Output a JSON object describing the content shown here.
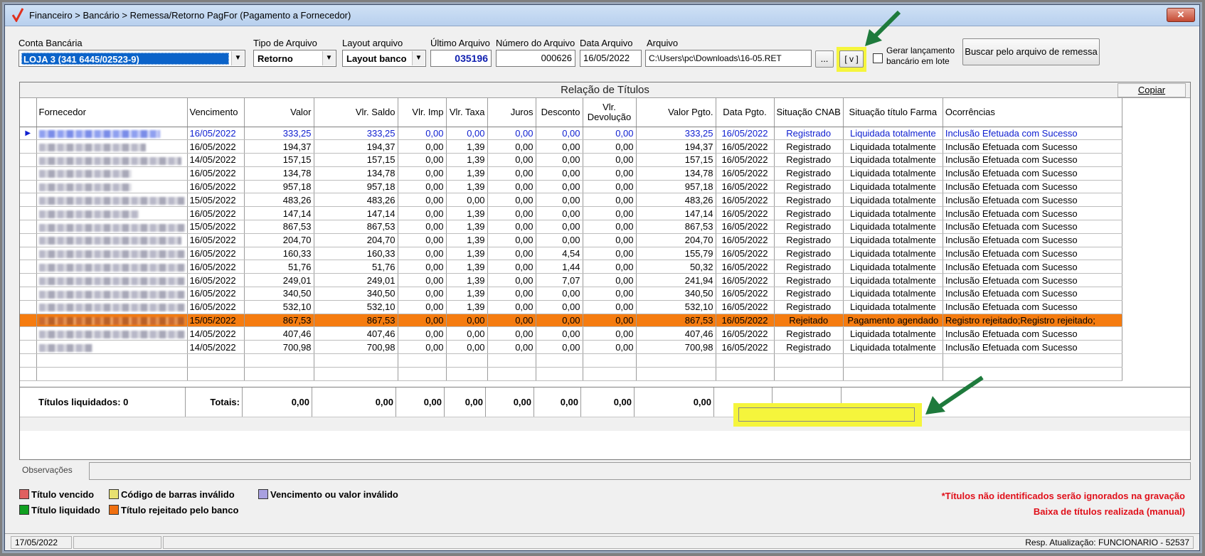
{
  "window": {
    "title": "Financeiro > Bancário > Remessa/Retorno PagFor (Pagamento  a Fornecedor)",
    "close_label": "✕"
  },
  "filters": {
    "conta_label": "Conta Bancária",
    "conta_value": "LOJA 3 (341 6445/02523-9)",
    "tipo_label": "Tipo de Arquivo",
    "tipo_value": "Retorno",
    "layout_label": "Layout arquivo",
    "layout_value": "Layout banco",
    "ultimo_label": "Último Arquivo",
    "ultimo_value": "035196",
    "numero_label": "Número do Arquivo",
    "numero_value": "000626",
    "data_label": "Data Arquivo",
    "data_value": "16/05/2022",
    "arquivo_label": "Arquivo",
    "arquivo_value": "C:\\Users\\pc\\Downloads\\16-05.RET",
    "browse_label": "...",
    "validate_label": "[ v ]",
    "gerar_label_1": "Gerar lançamento",
    "gerar_label_2": "bancário em lote",
    "buscar_label": "Buscar pelo arquivo de remessa"
  },
  "grid": {
    "caption": "Relação de Títulos",
    "copiar_label": "Copiar",
    "columns": [
      {
        "label": "Fornecedor"
      },
      {
        "label": "Vencimento"
      },
      {
        "label": "Valor"
      },
      {
        "label": "Vlr. Saldo"
      },
      {
        "label": "Vlr. Imp"
      },
      {
        "label": "Vlr. Taxa"
      },
      {
        "label": "Juros"
      },
      {
        "label": "Desconto"
      },
      {
        "label": "Vlr. Devolução"
      },
      {
        "label": "Valor Pgto."
      },
      {
        "label": "Data Pgto."
      },
      {
        "label": "Situação CNAB"
      },
      {
        "label": "Situação título Farma"
      },
      {
        "label": "Ocorrências"
      }
    ],
    "rows": [
      {
        "w": 170,
        "venc": "16/05/2022",
        "valor": "333,25",
        "saldo": "333,25",
        "imp": "0,00",
        "taxa": "0,00",
        "juros": "0,00",
        "desc": "0,00",
        "devol": "0,00",
        "pgto": "333,25",
        "data": "16/05/2022",
        "cnab": "Registrado",
        "farma": "Liquidada totalmente",
        "ocor": "Inclusão Efetuada com Sucesso",
        "style": "blue",
        "current": true
      },
      {
        "w": 150,
        "venc": "16/05/2022",
        "valor": "194,37",
        "saldo": "194,37",
        "imp": "0,00",
        "taxa": "1,39",
        "juros": "0,00",
        "desc": "0,00",
        "devol": "0,00",
        "pgto": "194,37",
        "data": "16/05/2022",
        "cnab": "Registrado",
        "farma": "Liquidada totalmente",
        "ocor": "Inclusão Efetuada com Sucesso",
        "style": ""
      },
      {
        "w": 200,
        "venc": "14/05/2022",
        "valor": "157,15",
        "saldo": "157,15",
        "imp": "0,00",
        "taxa": "1,39",
        "juros": "0,00",
        "desc": "0,00",
        "devol": "0,00",
        "pgto": "157,15",
        "data": "16/05/2022",
        "cnab": "Registrado",
        "farma": "Liquidada totalmente",
        "ocor": "Inclusão Efetuada com Sucesso",
        "style": ""
      },
      {
        "w": 130,
        "venc": "16/05/2022",
        "valor": "134,78",
        "saldo": "134,78",
        "imp": "0,00",
        "taxa": "1,39",
        "juros": "0,00",
        "desc": "0,00",
        "devol": "0,00",
        "pgto": "134,78",
        "data": "16/05/2022",
        "cnab": "Registrado",
        "farma": "Liquidada totalmente",
        "ocor": "Inclusão Efetuada com Sucesso",
        "style": ""
      },
      {
        "w": 130,
        "venc": "16/05/2022",
        "valor": "957,18",
        "saldo": "957,18",
        "imp": "0,00",
        "taxa": "1,39",
        "juros": "0,00",
        "desc": "0,00",
        "devol": "0,00",
        "pgto": "957,18",
        "data": "16/05/2022",
        "cnab": "Registrado",
        "farma": "Liquidada totalmente",
        "ocor": "Inclusão Efetuada com Sucesso",
        "style": ""
      },
      {
        "w": 205,
        "venc": "15/05/2022",
        "valor": "483,26",
        "saldo": "483,26",
        "imp": "0,00",
        "taxa": "0,00",
        "juros": "0,00",
        "desc": "0,00",
        "devol": "0,00",
        "pgto": "483,26",
        "data": "16/05/2022",
        "cnab": "Registrado",
        "farma": "Liquidada totalmente",
        "ocor": "Inclusão Efetuada com Sucesso",
        "style": ""
      },
      {
        "w": 140,
        "venc": "16/05/2022",
        "valor": "147,14",
        "saldo": "147,14",
        "imp": "0,00",
        "taxa": "1,39",
        "juros": "0,00",
        "desc": "0,00",
        "devol": "0,00",
        "pgto": "147,14",
        "data": "16/05/2022",
        "cnab": "Registrado",
        "farma": "Liquidada totalmente",
        "ocor": "Inclusão Efetuada com Sucesso",
        "style": ""
      },
      {
        "w": 205,
        "venc": "15/05/2022",
        "valor": "867,53",
        "saldo": "867,53",
        "imp": "0,00",
        "taxa": "1,39",
        "juros": "0,00",
        "desc": "0,00",
        "devol": "0,00",
        "pgto": "867,53",
        "data": "16/05/2022",
        "cnab": "Registrado",
        "farma": "Liquidada totalmente",
        "ocor": "Inclusão Efetuada com Sucesso",
        "style": ""
      },
      {
        "w": 200,
        "venc": "16/05/2022",
        "valor": "204,70",
        "saldo": "204,70",
        "imp": "0,00",
        "taxa": "1,39",
        "juros": "0,00",
        "desc": "0,00",
        "devol": "0,00",
        "pgto": "204,70",
        "data": "16/05/2022",
        "cnab": "Registrado",
        "farma": "Liquidada totalmente",
        "ocor": "Inclusão Efetuada com Sucesso",
        "style": ""
      },
      {
        "w": 205,
        "venc": "16/05/2022",
        "valor": "160,33",
        "saldo": "160,33",
        "imp": "0,00",
        "taxa": "1,39",
        "juros": "0,00",
        "desc": "4,54",
        "devol": "0,00",
        "pgto": "155,79",
        "data": "16/05/2022",
        "cnab": "Registrado",
        "farma": "Liquidada totalmente",
        "ocor": "Inclusão Efetuada com Sucesso",
        "style": ""
      },
      {
        "w": 205,
        "venc": "16/05/2022",
        "valor": "51,76",
        "saldo": "51,76",
        "imp": "0,00",
        "taxa": "1,39",
        "juros": "0,00",
        "desc": "1,44",
        "devol": "0,00",
        "pgto": "50,32",
        "data": "16/05/2022",
        "cnab": "Registrado",
        "farma": "Liquidada totalmente",
        "ocor": "Inclusão Efetuada com Sucesso",
        "style": ""
      },
      {
        "w": 205,
        "venc": "16/05/2022",
        "valor": "249,01",
        "saldo": "249,01",
        "imp": "0,00",
        "taxa": "1,39",
        "juros": "0,00",
        "desc": "7,07",
        "devol": "0,00",
        "pgto": "241,94",
        "data": "16/05/2022",
        "cnab": "Registrado",
        "farma": "Liquidada totalmente",
        "ocor": "Inclusão Efetuada com Sucesso",
        "style": ""
      },
      {
        "w": 205,
        "venc": "16/05/2022",
        "valor": "340,50",
        "saldo": "340,50",
        "imp": "0,00",
        "taxa": "1,39",
        "juros": "0,00",
        "desc": "0,00",
        "devol": "0,00",
        "pgto": "340,50",
        "data": "16/05/2022",
        "cnab": "Registrado",
        "farma": "Liquidada totalmente",
        "ocor": "Inclusão Efetuada com Sucesso",
        "style": ""
      },
      {
        "w": 205,
        "venc": "16/05/2022",
        "valor": "532,10",
        "saldo": "532,10",
        "imp": "0,00",
        "taxa": "1,39",
        "juros": "0,00",
        "desc": "0,00",
        "devol": "0,00",
        "pgto": "532,10",
        "data": "16/05/2022",
        "cnab": "Registrado",
        "farma": "Liquidada totalmente",
        "ocor": "Inclusão Efetuada com Sucesso",
        "style": ""
      },
      {
        "w": 205,
        "venc": "15/05/2022",
        "valor": "867,53",
        "saldo": "867,53",
        "imp": "0,00",
        "taxa": "0,00",
        "juros": "0,00",
        "desc": "0,00",
        "devol": "0,00",
        "pgto": "867,53",
        "data": "16/05/2022",
        "cnab": "Rejeitado",
        "farma": "Pagamento agendado",
        "ocor": "Registro rejeitado;Registro rejeitado;",
        "style": "rej"
      },
      {
        "w": 205,
        "venc": "14/05/2022",
        "valor": "407,46",
        "saldo": "407,46",
        "imp": "0,00",
        "taxa": "0,00",
        "juros": "0,00",
        "desc": "0,00",
        "devol": "0,00",
        "pgto": "407,46",
        "data": "16/05/2022",
        "cnab": "Registrado",
        "farma": "Liquidada totalmente",
        "ocor": "Inclusão Efetuada com Sucesso",
        "style": ""
      },
      {
        "w": 75,
        "venc": "14/05/2022",
        "valor": "700,98",
        "saldo": "700,98",
        "imp": "0,00",
        "taxa": "0,00",
        "juros": "0,00",
        "desc": "0,00",
        "devol": "0,00",
        "pgto": "700,98",
        "data": "16/05/2022",
        "cnab": "Registrado",
        "farma": "Liquidada totalmente",
        "ocor": "Inclusão Efetuada com Sucesso",
        "style": ""
      }
    ],
    "totals": {
      "liquidados": "Títulos liquidados: 0",
      "label": "Totais:",
      "valor": "0,00",
      "saldo": "0,00",
      "imp": "0,00",
      "taxa": "0,00",
      "juros": "0,00",
      "desc": "0,00",
      "devol": "0,00",
      "pgto": "0,00"
    }
  },
  "observacoes_label": "Observações",
  "legend": {
    "vencido": "Título vencido",
    "codigo": "Código de barras inválido",
    "venc_valor": "Vencimento ou valor inválido",
    "liquidado": "Título liquidado",
    "rejeitado": "Título rejeitado pelo banco",
    "colors": {
      "vencido": "#e06060",
      "codigo": "#e8e070",
      "venc_valor": "#a8a0e0",
      "liquidado": "#10a020",
      "rejeitado": "#f07010"
    }
  },
  "notices": {
    "line1": "*Títulos não identificados serão ignorados na gravação",
    "line2": "Baixa de títulos realizada (manual)"
  },
  "status": {
    "date": "17/05/2022",
    "resp": "Resp. Atualização: FUNCIONARIO - 52537"
  },
  "colors": {
    "highlight": "#f5f53c",
    "arrow": "#1e7a3c",
    "rejected_row": "#f57c10",
    "selected": "#0b63c9"
  }
}
